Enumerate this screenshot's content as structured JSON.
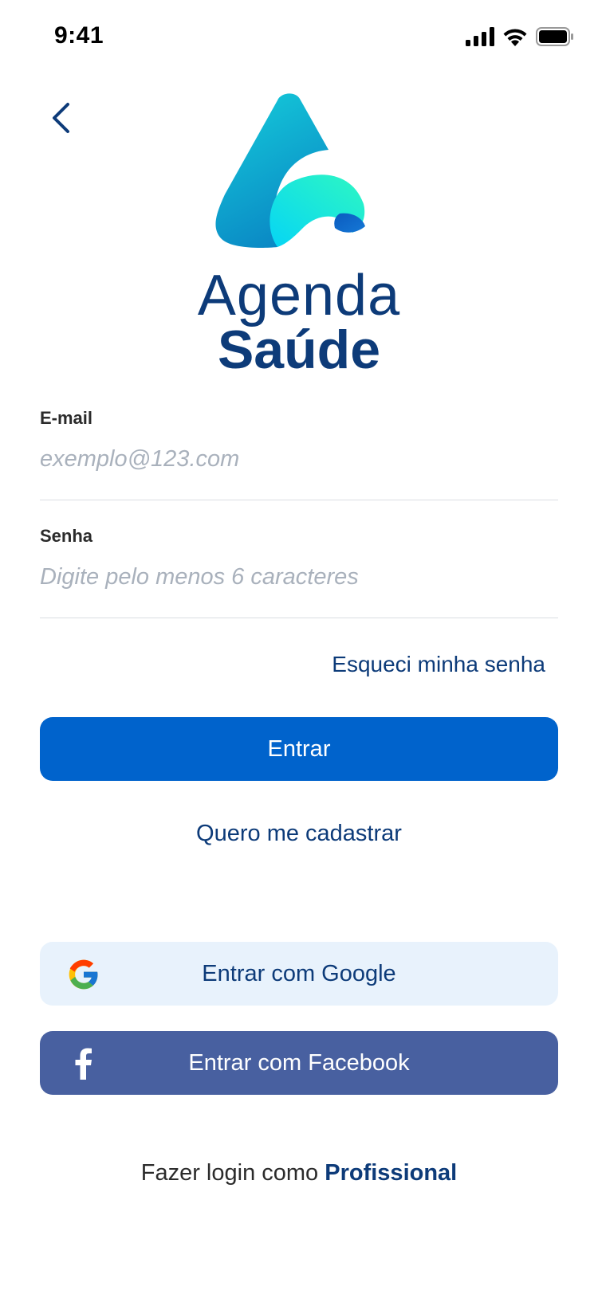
{
  "status_bar": {
    "time": "9:41"
  },
  "logo": {
    "line1": "Agenda",
    "line2": "Saúde"
  },
  "form": {
    "email_label": "E-mail",
    "email_placeholder": "exemplo@123.com",
    "password_label": "Senha",
    "password_placeholder": "Digite pelo menos 6 caracteres"
  },
  "links": {
    "forgot_password": "Esqueci minha senha",
    "register": "Quero me cadastrar"
  },
  "buttons": {
    "login": "Entrar",
    "google": "Entrar com Google",
    "facebook": "Entrar com Facebook"
  },
  "footer": {
    "prefix": "Fazer login como",
    "link": "Profissional"
  },
  "colors": {
    "primary": "#0063cc",
    "brand_dark": "#0d3b79",
    "google_bg": "#e8f2fc",
    "facebook_bg": "#4860a0"
  },
  "icons": [
    "back-chevron-icon",
    "signal-icon",
    "wifi-icon",
    "battery-icon",
    "google-icon",
    "facebook-icon"
  ]
}
